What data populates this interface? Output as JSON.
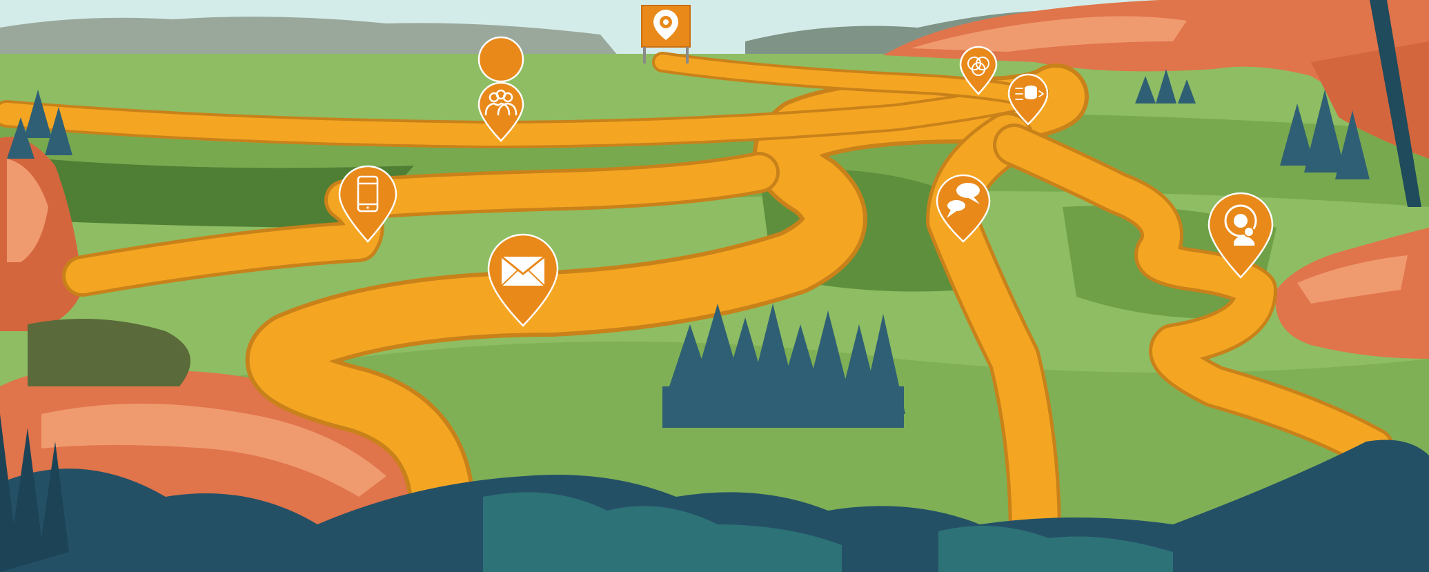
{
  "scene": {
    "colors": {
      "sky": "#d4ece9",
      "far_hills": "#9aa89c",
      "meadow_light": "#8fbd63",
      "meadow_mid": "#6f9f47",
      "meadow_dark": "#4f7f34",
      "path": "#f4a623",
      "path_shadow": "#c9811a",
      "pin_orange": "#e8891a",
      "rock_orange": "#e0744a",
      "rock_light": "#f09a70",
      "pine": "#2f5f74",
      "foreground_teal": "#245066"
    },
    "pins": [
      {
        "id": "start",
        "icon": "location-target-icon"
      },
      {
        "id": "community",
        "icon": "people-group-icon"
      },
      {
        "id": "mobile",
        "icon": "smartphone-icon"
      },
      {
        "id": "email",
        "icon": "envelope-icon"
      },
      {
        "id": "integration",
        "icon": "interlocking-rings-icon"
      },
      {
        "id": "data",
        "icon": "database-flow-icon"
      },
      {
        "id": "chat",
        "icon": "chat-bubbles-icon"
      },
      {
        "id": "support",
        "icon": "headset-agent-icon"
      }
    ]
  }
}
